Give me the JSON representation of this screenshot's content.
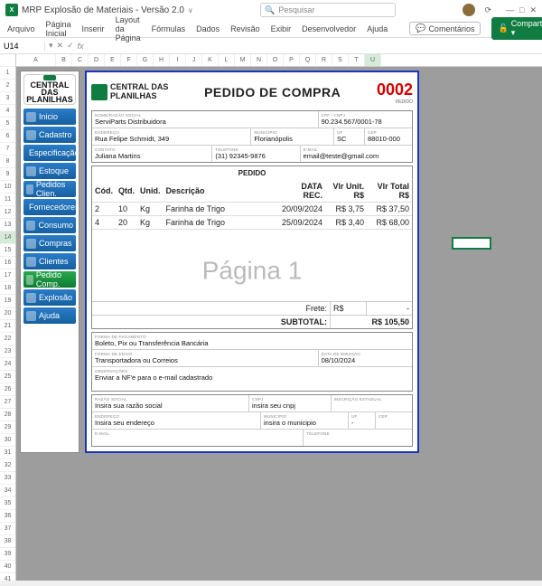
{
  "titlebar": {
    "doc": "MRP Explosão de Materiais - Versão 2.0",
    "search": "Pesquisar"
  },
  "ribbon": {
    "tabs": [
      "Arquivo",
      "Página Inicial",
      "Inserir",
      "Layout da Página",
      "Fórmulas",
      "Dados",
      "Revisão",
      "Exibir",
      "Desenvolvedor",
      "Ajuda"
    ],
    "comments": "Comentários",
    "share": "Compartilhamento"
  },
  "namebox": "U14",
  "fx": "fx",
  "cols": [
    "A",
    "B",
    "C",
    "D",
    "E",
    "F",
    "G",
    "H",
    "I",
    "J",
    "K",
    "L",
    "M",
    "N",
    "O",
    "P",
    "Q",
    "R",
    "S",
    "T",
    "U"
  ],
  "rows": [
    "1",
    "2",
    "3",
    "4",
    "5",
    "6",
    "7",
    "8",
    "9",
    "10",
    "11",
    "12",
    "13",
    "14",
    "15",
    "16",
    "17",
    "18",
    "19",
    "20",
    "21",
    "22",
    "23",
    "24",
    "25",
    "26",
    "27",
    "28",
    "29",
    "30",
    "31",
    "32",
    "33",
    "34",
    "35",
    "36",
    "37",
    "38",
    "39",
    "40",
    "41"
  ],
  "sidebar": {
    "brand_l1": "CENTRAL DAS",
    "brand_l2": "PLANILHAS",
    "items": [
      "Inicio",
      "Cadastro",
      "Especificação",
      "Estoque",
      "Pedidos Clien.",
      "Fornecedores",
      "Consumo",
      "Compras",
      "Clientes",
      "Pedido Comp.",
      "Explosão",
      "Ajuda"
    ],
    "selected": 9
  },
  "po": {
    "brand_l1": "CENTRAL DAS",
    "brand_l2": "PLANILHAS",
    "title": "PEDIDO DE COMPRA",
    "number": "0002",
    "number_label": "PEDIDO",
    "sup": {
      "razao_l": "NOME/RAZÃO SOCIAL",
      "razao": "ServiParts Distribuidora",
      "cpf_l": "CPF / CNPJ",
      "cpf": "90.234.567/0001-78",
      "end_l": "ENDEREÇO",
      "end": "Rua Felipe Schmidt, 349",
      "mun_l": "MUNICÍPIO",
      "mun": "Florianópolis",
      "uf_l": "UF",
      "uf": "SC",
      "cep_l": "CEP",
      "cep": "88010-000",
      "cont_l": "CONTATO",
      "cont": "Juliana Martins",
      "tel_l": "TELEFONE",
      "tel": "(31) 92345-9876",
      "mail_l": "E-MAIL",
      "mail": "email@teste@gmail.com"
    },
    "items_hdr": "PEDIDO",
    "th": {
      "cod": "Cód.",
      "qtd": "Qtd.",
      "unid": "Unid.",
      "desc": "Descrição",
      "data": "DATA REC.",
      "vu": "Vlr Unit. R$",
      "vt": "Vlr Total R$"
    },
    "items": [
      {
        "cod": "2",
        "qtd": "10",
        "unid": "Kg",
        "desc": "Farinha de Trigo",
        "data": "20/09/2024",
        "vu": "R$ 3,75",
        "vt": "R$ 37,50"
      },
      {
        "cod": "4",
        "qtd": "20",
        "unid": "Kg",
        "desc": "Farinha de Trigo",
        "data": "25/09/2024",
        "vu": "R$ 3,40",
        "vt": "R$ 68,00"
      }
    ],
    "frete_l": "Frete:",
    "frete_v": "R$",
    "frete_d": "-",
    "subtotal_l": "SUBTOTAL:",
    "subtotal_v": "R$ 105,50",
    "pay_l": "FORMA DE PAGAMENTO",
    "pay": "Boleto, Pix ou Transferência Bancária",
    "ship_l": "FORMA DE ENVIO",
    "ship": "Transportadora ou Correios",
    "emiss_l": "DATA DE EMISSÃO",
    "emiss": "08/10/2024",
    "obs_l": "OBSERVAÇÕES",
    "obs": "Enviar a NF'e para o e-mail cadastrado",
    "buyer": {
      "razao_l": "RAZÃO SOCIAL",
      "razao": "Insira sua razão social",
      "cnpj_l": "CNPJ",
      "cnpj": "insira seu cnpj",
      "ie_l": "INSCRIÇÃO ESTADUAL",
      "ie": "",
      "end_l": "ENDEREÇO",
      "end": "Insira seu endereço",
      "mun_l": "MUNICÍPIO",
      "mun": "insira o municipio",
      "uf_l": "UF",
      "uf": "-",
      "cep_l": "CEP",
      "cep": "",
      "mail_l": "E-MAIL",
      "mail": "",
      "tel_l": "TELEFONE",
      "tel": ""
    }
  },
  "watermark": "Página 1"
}
